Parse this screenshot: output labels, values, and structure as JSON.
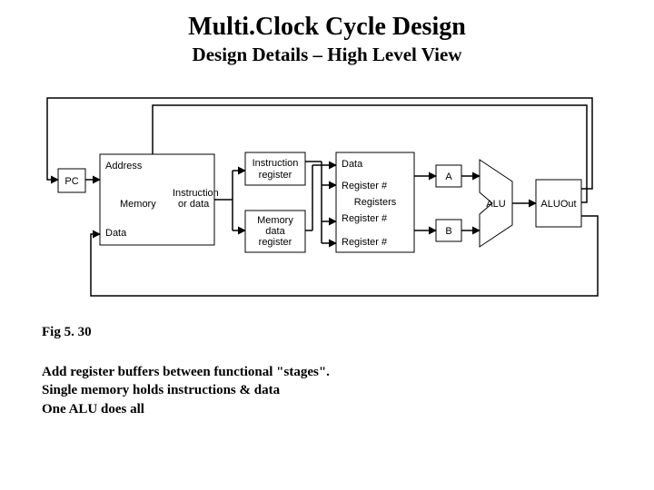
{
  "title": "Multi.Clock Cycle Design",
  "subtitle": "Design Details – High Level View",
  "caption": "Fig 5. 30",
  "notes": {
    "line1": "Add register buffers between functional \"stages\".",
    "line2": "Single memory holds instructions & data",
    "line3": "One ALU does all"
  },
  "diagram": {
    "pc": "PC",
    "memory_block": "Memory",
    "mem_addr": "Address",
    "mem_instr_or_data1": "Instruction",
    "mem_instr_or_data2": "or data",
    "mem_data": "Data",
    "instr_reg1": "Instruction",
    "instr_reg2": "register",
    "mem_data_reg1": "Memory",
    "mem_data_reg2": "data",
    "mem_data_reg3": "register",
    "regfile_data": "Data",
    "regfile_regno1": "Register #",
    "regfile_label": "Registers",
    "regfile_regno2": "Register #",
    "regfile_regno3": "Register #",
    "a": "A",
    "b": "B",
    "alu": "ALU",
    "aluout": "ALUOut"
  }
}
